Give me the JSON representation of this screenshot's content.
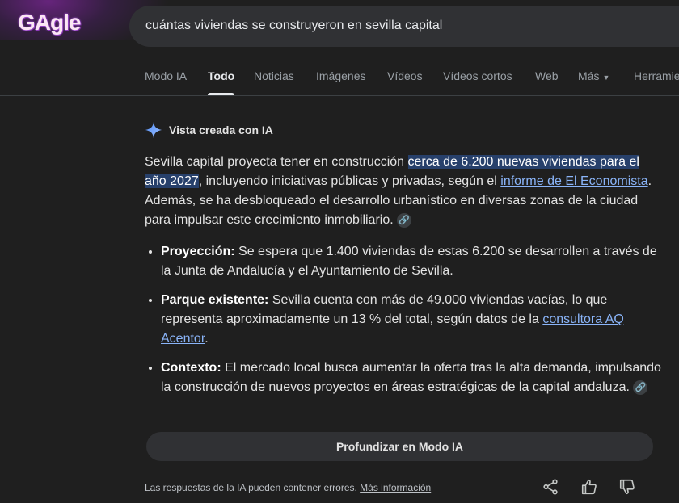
{
  "logo": {
    "text": "GAgle"
  },
  "search": {
    "query": "cuántas viviendas se construyeron en sevilla capital"
  },
  "tabs": [
    {
      "label": "Modo IA"
    },
    {
      "label": "Todo"
    },
    {
      "label": "Noticias"
    },
    {
      "label": "Imágenes"
    },
    {
      "label": "Vídeos"
    },
    {
      "label": "Vídeos cortos"
    },
    {
      "label": "Web"
    },
    {
      "label": "Más"
    },
    {
      "label": "Herramie"
    }
  ],
  "ai": {
    "header": "Vista creada con IA",
    "para": {
      "t1": "Sevilla capital proyecta tener en construcción ",
      "highlight": "cerca de 6.200 nuevas viviendas para el año 2027",
      "t2": ", incluyendo iniciativas públicas y privadas, según el ",
      "link": "informe de El Economista",
      "t3": ". Además, se ha desbloqueado el desarrollo urbanístico en diversas zonas de la ciudad para impulsar este crecimiento inmobiliario. "
    },
    "bullets": [
      {
        "title": "Proyección:",
        "text": " Se espera que 1.400 viviendas de estas 6.200 se desarrollen a través de la Junta de Andalucía y el Ayuntamiento de Sevilla.",
        "link": "",
        "after": ""
      },
      {
        "title": "Parque existente:",
        "text": " Sevilla cuenta con más de 49.000 viviendas vacías, lo que representa aproximadamente un 13 % del total, según datos de la ",
        "link": "consultora AQ Acentor",
        "after": "."
      },
      {
        "title": "Contexto:",
        "text": " El mercado local busca aumentar la oferta tras la alta demanda, impulsando la construcción de nuevos proyectos en áreas estratégicas de la capital andaluza. ",
        "link": "",
        "after": ""
      }
    ],
    "deep_button": "Profundizar en Modo IA",
    "footer": {
      "text": "Las respuestas de la IA pueden contener errores. ",
      "link": "Más información"
    }
  },
  "icons": {
    "sparkle": "sparkle-icon",
    "link": "link-icon",
    "share": "share-icon",
    "thumbs_up": "thumbs-up-icon",
    "thumbs_down": "thumbs-down-icon"
  },
  "colors": {
    "link": "#8ab4f8",
    "highlight": "#27406b",
    "background": "#1f1f1f"
  }
}
